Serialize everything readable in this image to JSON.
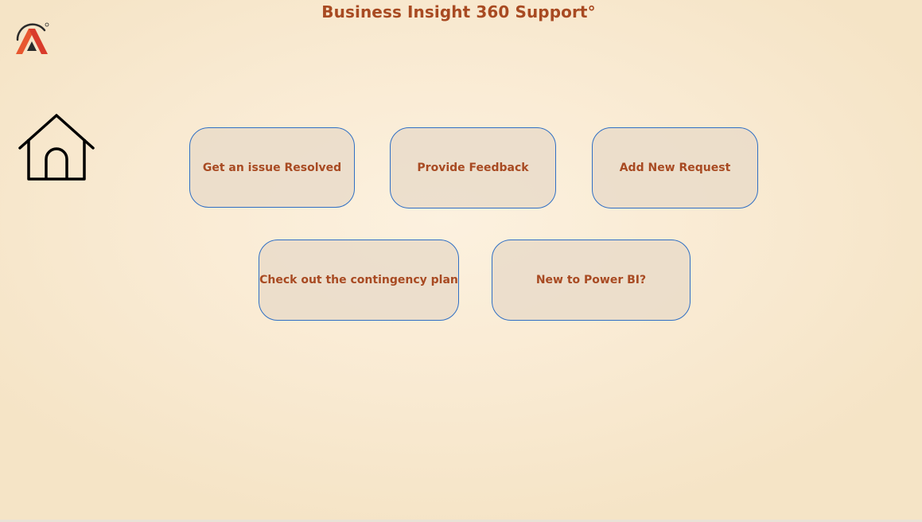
{
  "header": {
    "title": "Business Insight 360 Support°"
  },
  "logo": {
    "icon": "company-logo-icon",
    "colors": {
      "dark": "#2b2b2b",
      "orange": "#e8572f",
      "red": "#d93b2b"
    }
  },
  "nav": {
    "home_icon": "home-icon"
  },
  "tiles": [
    {
      "label": "Get an issue Resolved"
    },
    {
      "label": "Provide Feedback"
    },
    {
      "label": "Add New Request"
    },
    {
      "label": "Check out the contingency plan"
    },
    {
      "label": "New to Power BI?"
    }
  ],
  "colors": {
    "accent_text": "#a84a22",
    "tile_border": "#2f6fc4",
    "tile_fill": "#e8dac8",
    "background": "#f9ead2"
  }
}
